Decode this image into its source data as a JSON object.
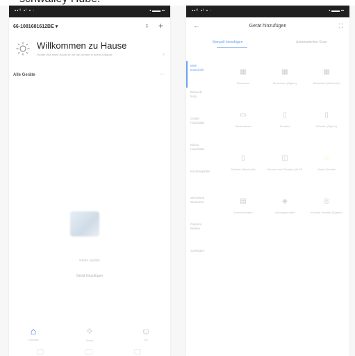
{
  "caption": "schwalley Hube.",
  "left_screen": {
    "status_left": "▪▪ᴵᴵ ▪ᴵ ▪ ·",
    "status_right": "▪ ▬▬ ▪▪",
    "home_name": "66-1081681612BE ▾",
    "welcome_title": "Willkommen zu Hause",
    "welcome_subtitle": "Richten Sie einen Raum ein für die Zimmer in Ihrem Zuhause",
    "devices_label": "Alle Geräte",
    "devices_more": "···",
    "empty_hint": "Keine Geräte",
    "add_device_link": "Gerät hinzufügen",
    "tabs": [
      {
        "label": "Zuhause",
        "icon": "home-icon"
      },
      {
        "label": "Smart",
        "icon": "smart-icon"
      },
      {
        "label": "Ich",
        "icon": "profile-icon"
      }
    ]
  },
  "right_screen": {
    "status_left": "▪▪ᴵᴵ ▪ᴵ ▪ ·",
    "status_right": "▪ ▬▬ ▪▪",
    "title": "Gerät hinzufügen",
    "tabs": [
      "Manuell hinzufügen",
      "Automatischer Scan"
    ],
    "categories": [
      "Elek-\ntrotechnik",
      "Beleuch-\ntung",
      "Große\nHaushalts",
      "Kleine\nHaushalts",
      "Küchengeräte",
      "Sicherheit\nSensoren",
      "Outdoor\nReisen",
      "Sonstiges"
    ],
    "devices": [
      {
        "label": "Steckdose",
        "icon": "socket-icon"
      },
      {
        "label": "Steckdose (Zigbee)",
        "icon": "socket-icon"
      },
      {
        "label": "Steckdose (Bluetooth)",
        "icon": "socket-icon"
      },
      {
        "label": "Steckerleiste",
        "icon": "strip-icon"
      },
      {
        "label": "Schalter",
        "icon": "switch-icon"
      },
      {
        "label": "Schalter (Zigbee)",
        "icon": "switch-icon"
      },
      {
        "label": "Schalter (Bluetooth)",
        "icon": "switch-icon"
      },
      {
        "label": "Dimmer und Schalter (Wi-Fi)",
        "icon": "dimmer-icon"
      },
      {
        "label": "Wand-Schalter",
        "icon": "bulb-icon"
      },
      {
        "label": "Szenenschalter",
        "icon": "scene-icon"
      },
      {
        "label": "Vorhangschalter",
        "icon": "curtain-icon"
      },
      {
        "label": "Kontakt Schalter (Zigbee)",
        "icon": "contact-icon"
      }
    ]
  }
}
